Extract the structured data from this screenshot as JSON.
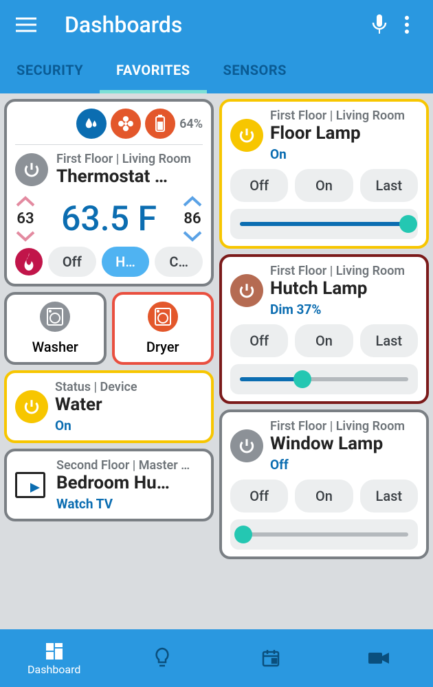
{
  "header": {
    "title": "Dashboards"
  },
  "tabs": [
    "SECURITY",
    "FAVORITES",
    "SENSORS"
  ],
  "active_tab": 1,
  "thermostat": {
    "battery_pct": "64%",
    "location": "First Floor | Living Room",
    "name": "Thermostat …",
    "low_set": "63",
    "high_set": "86",
    "current": "63.5 F",
    "modes": [
      "Off",
      "H…",
      "C…"
    ],
    "active_mode": 1
  },
  "appliances": {
    "washer": "Washer",
    "dryer": "Dryer"
  },
  "water": {
    "location": "Status | Device",
    "name": "Water",
    "state": "On"
  },
  "bedroom": {
    "location": "Second Floor | Master …",
    "name": "Bedroom Hu…",
    "state": "Watch TV"
  },
  "floor_lamp": {
    "location": "First Floor | Living Room",
    "name": "Floor Lamp",
    "state": "On",
    "buttons": [
      "Off",
      "On",
      "Last"
    ],
    "level": 100
  },
  "hutch_lamp": {
    "location": "First Floor | Living Room",
    "name": "Hutch Lamp",
    "state": "Dim 37%",
    "buttons": [
      "Off",
      "On",
      "Last"
    ],
    "level": 37
  },
  "window_lamp": {
    "location": "First Floor | Living Room",
    "name": "Window Lamp",
    "state": "Off",
    "buttons": [
      "Off",
      "On",
      "Last"
    ],
    "level": 2
  },
  "bottom": {
    "dashboard": "Dashboard"
  }
}
